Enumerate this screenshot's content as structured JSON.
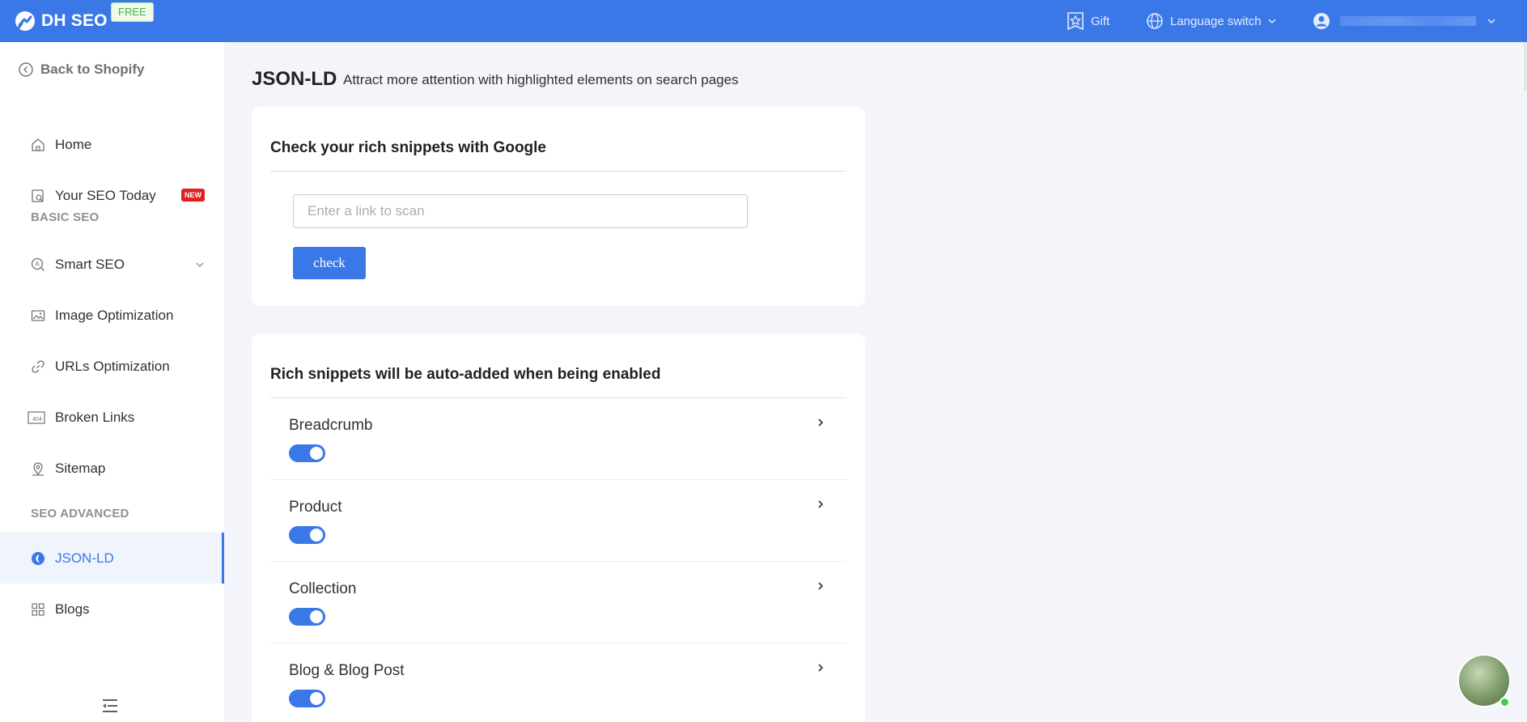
{
  "topbar": {
    "brand": "DH SEO",
    "plan_badge": "FREE",
    "gift_label": "Gift",
    "language_label": "Language switch"
  },
  "sidebar": {
    "back_label": "Back to Shopify",
    "items": [
      {
        "label": "Home",
        "icon": "home-icon"
      },
      {
        "label": "Your SEO Today",
        "icon": "seo-today-icon",
        "badge": "NEW"
      },
      {
        "label": "Smart SEO",
        "icon": "smart-seo-icon"
      },
      {
        "label": "Image Optimization",
        "icon": "image-icon"
      },
      {
        "label": "URLs Optimization",
        "icon": "link-icon"
      },
      {
        "label": "Broken Links",
        "icon": "404-icon"
      },
      {
        "label": "Sitemap",
        "icon": "location-icon"
      },
      {
        "label": "JSON-LD",
        "icon": "json-ld-icon",
        "active": true
      },
      {
        "label": "Blogs",
        "icon": "grid-icon"
      }
    ],
    "section_basic": "BASIC SEO",
    "section_advanced": "SEO ADVANCED"
  },
  "main": {
    "title": "JSON-LD",
    "subtitle": "Attract more attention with highlighted elements on search pages",
    "check_card": {
      "title": "Check your rich snippets with Google",
      "input_placeholder": "Enter a link to scan",
      "input_value": "",
      "button_label": "check"
    },
    "snippets_card": {
      "title": "Rich snippets will be auto-added when being enabled",
      "items": [
        {
          "label": "Breadcrumb",
          "enabled": true
        },
        {
          "label": "Product",
          "enabled": true
        },
        {
          "label": "Collection",
          "enabled": true
        },
        {
          "label": "Blog & Blog Post",
          "enabled": true
        }
      ]
    }
  },
  "colors": {
    "primary": "#3b78e7",
    "new_badge": "#e02020",
    "online_dot": "#3ecf4a"
  }
}
